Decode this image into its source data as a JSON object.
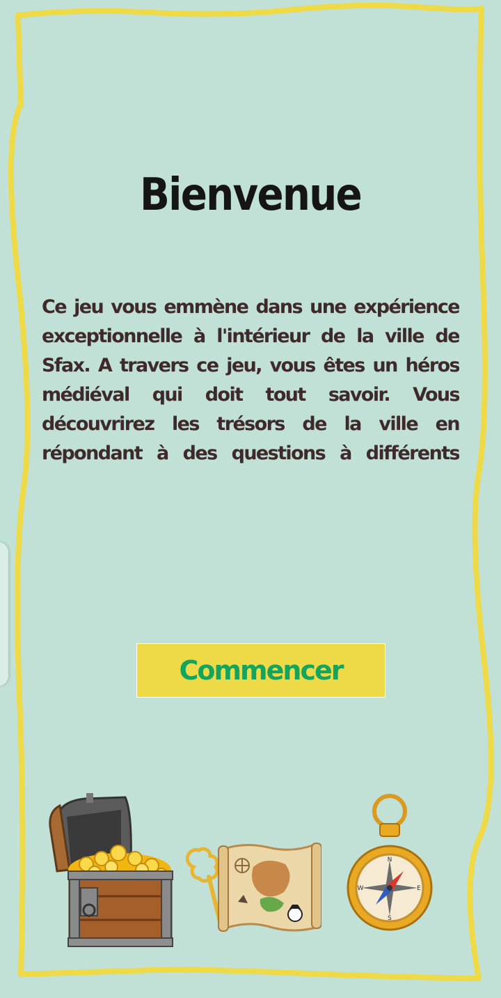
{
  "welcome": {
    "title": "Bienvenue",
    "intro": "Ce jeu vous emmène dans une expérience exceptionnelle à l'intérieur de la ville de Sfax. A travers ce jeu, vous êtes un héros médiéval qui doit tout savoir. Vous découvrirez les trésors de la ville en répondant à des questions à différents endroits. Suivez les instructions du jeu et il vous",
    "start_label": "Commencer"
  },
  "compass_letters": {
    "north": "N",
    "east": "E",
    "south": "S",
    "west": "W"
  },
  "colors": {
    "background": "#c1e1d7",
    "frame_border": "#eed946",
    "button_bg": "#eed946",
    "button_text": "#14a45e",
    "title_text": "#151515",
    "body_text": "#3e2a2a"
  },
  "icons": {
    "chest": "treasure-chest-icon",
    "key": "golden-key-icon",
    "map": "treasure-map-icon",
    "compass": "compass-icon"
  }
}
